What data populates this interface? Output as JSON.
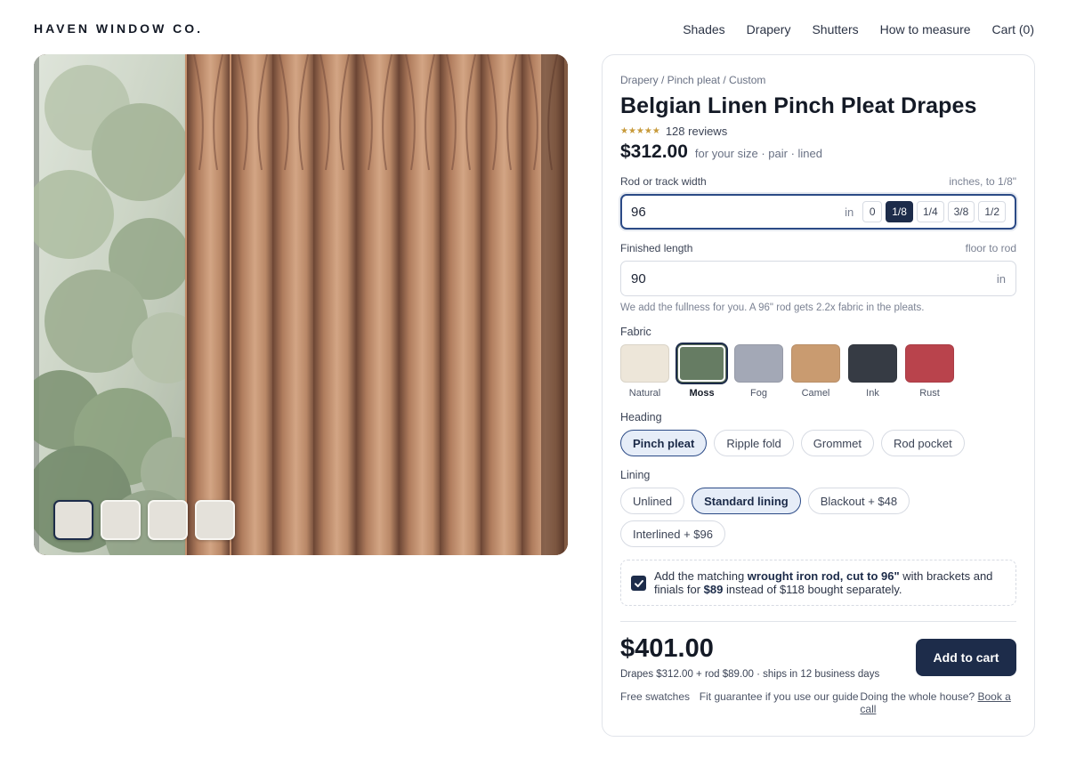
{
  "brand": "HAVEN WINDOW CO.",
  "nav": [
    "Shades",
    "Drapery",
    "Shutters",
    "How to measure",
    "Cart (0)"
  ],
  "gallery": {
    "thumb_count": 4,
    "active_thumb": 0
  },
  "product": {
    "breadcrumb": "Drapery / Pinch pleat / Custom",
    "title": "Belgian Linen Pinch Pleat Drapes",
    "stars": "★★★★★",
    "reviews": "128 reviews",
    "price": "$312.00",
    "price_note": "for your size · pair · lined"
  },
  "width": {
    "label": "Rod or track width",
    "hint": "inches, to 1/8\"",
    "value": "96",
    "unit": "in",
    "fractions": [
      "0",
      "1/8",
      "1/4",
      "3/8",
      "1/2"
    ],
    "selected_fraction": "1/8"
  },
  "length": {
    "label": "Finished length",
    "hint": "floor to rod",
    "value": "90",
    "unit": "in",
    "help": "We add the fullness for you. A 96\" rod gets 2.2x fabric in the pleats."
  },
  "fabric": {
    "label": "Fabric",
    "selected": "Moss",
    "options": [
      {
        "name": "Natural",
        "color": "#ede6d9"
      },
      {
        "name": "Moss",
        "color": "#667c63"
      },
      {
        "name": "Fog",
        "color": "#a3a8b6"
      },
      {
        "name": "Camel",
        "color": "#c99b70"
      },
      {
        "name": "Ink",
        "color": "#363b44"
      },
      {
        "name": "Rust",
        "color": "#b9434c"
      }
    ]
  },
  "heading": {
    "label": "Heading",
    "options": [
      "Pinch pleat",
      "Ripple fold",
      "Grommet",
      "Rod pocket"
    ],
    "selected": "Pinch pleat"
  },
  "lining": {
    "label": "Lining",
    "options": [
      "Unlined",
      "Standard lining",
      "Blackout + $48",
      "Interlined + $96"
    ],
    "selected": "Standard lining"
  },
  "addon": {
    "checked": true,
    "text_1": "Add the matching ",
    "bold_1": "wrought iron rod, cut to 96\"",
    "text_2": " with brackets and finials for ",
    "bold_2": "$89",
    "text_3": " instead of $118 bought separately."
  },
  "summary": {
    "total": "$401.00",
    "note": "Drapes $312.00 + rod $89.00 · ships in 12 business days",
    "cta": "Add to cart"
  },
  "footer": {
    "swatches": "Free swatches",
    "guarantee": "Fit guarantee if you use our guide",
    "house_text": "Doing the whole house? ",
    "house_link": "Book a call"
  },
  "colors": {
    "navy": "#1d2c4a",
    "curtain": "#c4906d",
    "star": "#c79a3a"
  }
}
